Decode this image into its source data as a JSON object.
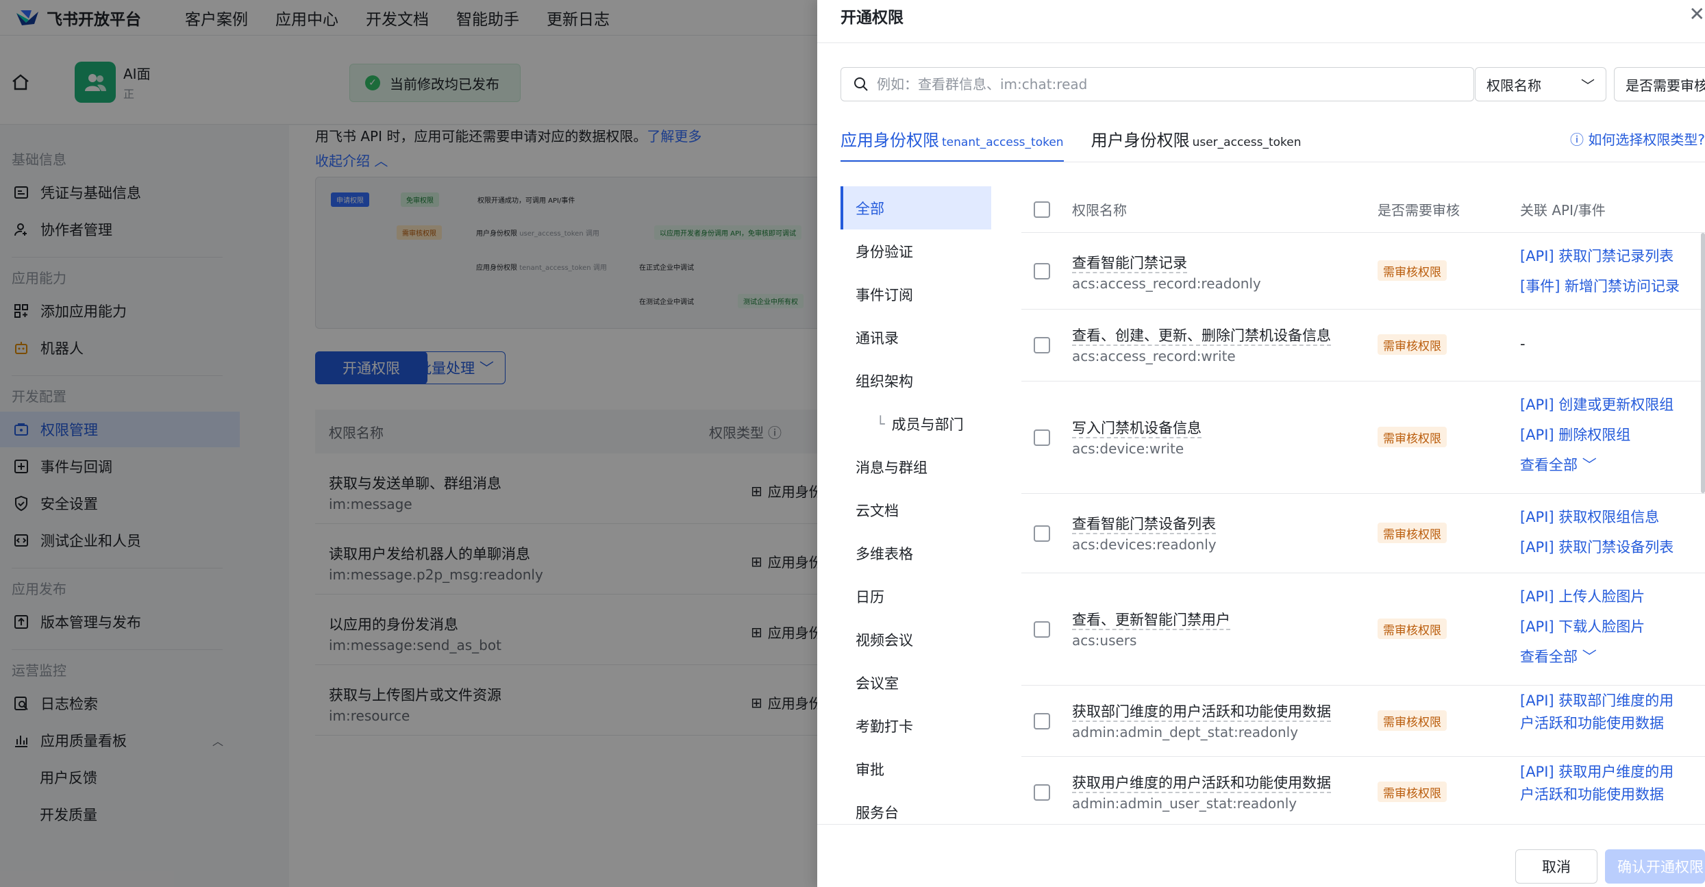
{
  "brand": {
    "name": "飞书开放平台"
  },
  "topnav": [
    "客户案例",
    "应用中心",
    "开发文档",
    "智能助手",
    "更新日志"
  ],
  "app": {
    "name": "AI面",
    "status": "正"
  },
  "toast": {
    "text": "当前修改均已发布"
  },
  "sidebar": {
    "groups": [
      {
        "title": "基础信息",
        "items": [
          {
            "label": "凭证与基础信息",
            "icon": "credential-icon"
          },
          {
            "label": "协作者管理",
            "icon": "user-icon"
          }
        ]
      },
      {
        "title": "应用能力",
        "items": [
          {
            "label": "添加应用能力",
            "icon": "grid-icon"
          },
          {
            "label": "机器人",
            "icon": "robot-icon"
          }
        ]
      },
      {
        "title": "开发配置",
        "items": [
          {
            "label": "权限管理",
            "icon": "permission-icon"
          },
          {
            "label": "事件与回调",
            "icon": "event-icon"
          },
          {
            "label": "安全设置",
            "icon": "shield-icon"
          },
          {
            "label": "测试企业和人员",
            "icon": "test-icon"
          }
        ]
      },
      {
        "title": "应用发布",
        "items": [
          {
            "label": "版本管理与发布",
            "icon": "upload-icon"
          }
        ]
      },
      {
        "title": "运营监控",
        "items": [
          {
            "label": "日志检索",
            "icon": "log-search-icon"
          },
          {
            "label": "应用质量看板",
            "icon": "chart-icon"
          },
          {
            "label": "用户反馈",
            "icon": ""
          },
          {
            "label": "开发质量",
            "icon": ""
          }
        ]
      }
    ]
  },
  "main": {
    "intro": "用飞书 API 时，应用可能还需要申请对应的数据权限。",
    "learn_more": "了解更多",
    "collapse": "收起介绍",
    "diagram": {
      "apply": "申请权限",
      "free": "免审权限",
      "free_result": "权限开通成功，可调用 API/事件",
      "review": "需审核权限",
      "user_token": "用户身份权限",
      "user_token_code": "user_access_token 调用",
      "user_result": "以应用开发者身份调用 API，免审核即可调试",
      "tenant_token": "应用身份权限",
      "tenant_token_code": "tenant_access_token 调用",
      "in_prod": "在正式企业中调试",
      "in_test": "在测试企业中调试",
      "test_result": "测试企业中所有权"
    },
    "open_btn": "开通权限",
    "batch_btn": "批量处理",
    "table": {
      "col_name": "权限名称",
      "col_type": "权限类型",
      "rows": [
        {
          "name": "获取与发送单聊、群组消息",
          "code": "im:message",
          "type": "应用身份"
        },
        {
          "name": "读取用户发给机器人的单聊消息",
          "code": "im:message.p2p_msg:readonly",
          "type": "应用身份"
        },
        {
          "name": "以应用的身份发消息",
          "code": "im:message:send_as_bot",
          "type": "应用身份"
        },
        {
          "name": "获取与上传图片或文件资源",
          "code": "im:resource",
          "type": "应用身份"
        }
      ]
    }
  },
  "drawer": {
    "title": "开通权限",
    "search_placeholder": "例如：查看群信息、im:chat:read",
    "filter1": "权限名称",
    "filter2": "是否需要审核",
    "tab1": "应用身份权限",
    "tab1_code": "tenant_access_token",
    "tab2": "用户身份权限",
    "tab2_code": "user_access_token",
    "help": "如何选择权限类型?",
    "categories": [
      "全部",
      "身份验证",
      "事件订阅",
      "通讯录",
      "组织架构",
      "成员与部门",
      "消息与群组",
      "云文档",
      "多维表格",
      "日历",
      "视频会议",
      "会议室",
      "考勤打卡",
      "审批",
      "服务台"
    ],
    "headers": {
      "name": "权限名称",
      "review": "是否需要审核",
      "api": "关联 API/事件"
    },
    "rows": [
      {
        "name": "查看智能门禁记录",
        "code": "acs:access_record:readonly",
        "badge": "需审核权限",
        "apis": [
          "[API] 获取门禁记录列表",
          "[事件] 新增门禁访问记录"
        ]
      },
      {
        "name": "查看、创建、更新、删除门禁机设备信息",
        "code": "acs:access_record:write",
        "badge": "需审核权限",
        "apis": [
          "-"
        ]
      },
      {
        "name": "写入门禁机设备信息",
        "code": "acs:device:write",
        "badge": "需审核权限",
        "apis": [
          "[API] 创建或更新权限组",
          "[API] 删除权限组",
          "查看全部"
        ]
      },
      {
        "name": "查看智能门禁设备列表",
        "code": "acs:devices:readonly",
        "badge": "需审核权限",
        "apis": [
          "[API] 获取权限组信息",
          "[API] 获取门禁设备列表"
        ]
      },
      {
        "name": "查看、更新智能门禁用户",
        "code": "acs:users",
        "badge": "需审核权限",
        "apis": [
          "[API] 上传人脸图片",
          "[API] 下载人脸图片",
          "查看全部"
        ]
      },
      {
        "name": "获取部门维度的用户活跃和功能使用数据",
        "code": "admin:admin_dept_stat:readonly",
        "badge": "需审核权限",
        "apis": [
          "[API] 获取部门维度的用",
          "户活跃和功能使用数据"
        ]
      },
      {
        "name": "获取用户维度的用户活跃和功能使用数据",
        "code": "admin:admin_user_stat:readonly",
        "badge": "需审核权限",
        "apis": [
          "[API] 获取用户维度的用",
          "户活跃和功能使用数据"
        ]
      }
    ],
    "cancel": "取消",
    "confirm": "确认开通权限"
  }
}
